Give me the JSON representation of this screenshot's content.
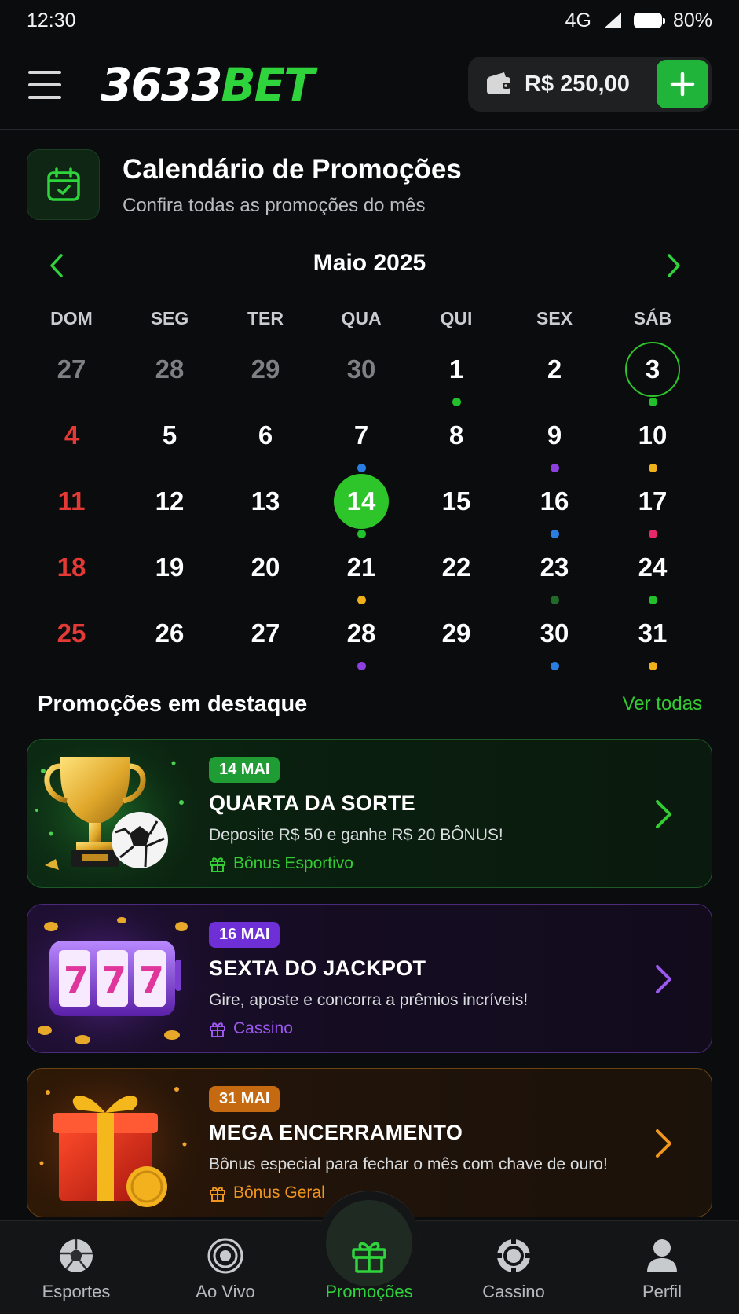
{
  "status_bar": {
    "time": "12:30",
    "network": "4G",
    "battery": "80%"
  },
  "header": {
    "logo_number": "3633",
    "logo_brand": "BET",
    "balance": "R$ 250,00"
  },
  "page": {
    "title": "Calendário de Promoções",
    "subtitle": "Confira todas as promoções do mês"
  },
  "calendar": {
    "month_label": "Maio 2025",
    "weekdays": [
      "DOM",
      "SEG",
      "TER",
      "QUA",
      "QUI",
      "SEX",
      "SÁB"
    ],
    "weeks": [
      [
        {
          "d": "27",
          "m": true
        },
        {
          "d": "28",
          "m": true
        },
        {
          "d": "29",
          "m": true
        },
        {
          "d": "30",
          "m": true
        },
        {
          "d": "1",
          "dot": "#22c02b"
        },
        {
          "d": "2"
        },
        {
          "d": "3",
          "dot": "#22c02b",
          "sel": true
        }
      ],
      [
        {
          "d": "4",
          "sun": true
        },
        {
          "d": "5"
        },
        {
          "d": "6"
        },
        {
          "d": "7",
          "dot": "#2a7de1"
        },
        {
          "d": "8"
        },
        {
          "d": "9",
          "dot": "#8e3fe0"
        },
        {
          "d": "10",
          "dot": "#f0b01a"
        }
      ],
      [
        {
          "d": "11",
          "sun": true
        },
        {
          "d": "12"
        },
        {
          "d": "13"
        },
        {
          "d": "14",
          "dot": "#22c02b",
          "today": true
        },
        {
          "d": "15"
        },
        {
          "d": "16",
          "dot": "#2a7de1"
        },
        {
          "d": "17",
          "dot": "#e9286a"
        }
      ],
      [
        {
          "d": "18",
          "sun": true
        },
        {
          "d": "19"
        },
        {
          "d": "20"
        },
        {
          "d": "21",
          "dot": "#f0b01a"
        },
        {
          "d": "22"
        },
        {
          "d": "23",
          "dot": "#1e6b2a"
        },
        {
          "d": "24",
          "dot": "#22c02b"
        }
      ],
      [
        {
          "d": "25",
          "sun": true
        },
        {
          "d": "26"
        },
        {
          "d": "27"
        },
        {
          "d": "28",
          "dot": "#8e3fe0"
        },
        {
          "d": "29"
        },
        {
          "d": "30",
          "dot": "#2a7de1"
        },
        {
          "d": "31",
          "dot": "#f0b01a"
        }
      ]
    ]
  },
  "featured": {
    "title": "Promoções em destaque",
    "see_all": "Ver todas",
    "promos": [
      {
        "badge": "14 MAI",
        "title": "QUARTA DA SORTE",
        "desc": "Deposite R$ 50 e ganhe R$ 20 BÔNUS!",
        "category": "Bônus Esportivo",
        "accent": "#33cc33"
      },
      {
        "badge": "16 MAI",
        "title": "SEXTA DO JACKPOT",
        "desc": "Gire, aposte e concorra a prêmios incríveis!",
        "category": "Cassino",
        "accent": "#9b59f0"
      },
      {
        "badge": "31 MAI",
        "title": "MEGA ENCERRAMENTO",
        "desc": "Bônus especial para fechar o mês com chave de ouro!",
        "category": "Bônus Geral",
        "accent": "#f0961f"
      }
    ]
  },
  "bottom_nav": {
    "items": [
      {
        "label": "Esportes",
        "icon": "soccer-ball-icon"
      },
      {
        "label": "Ao Vivo",
        "icon": "live-broadcast-icon"
      },
      {
        "label": "Promoções",
        "icon": "gift-icon",
        "active": true
      },
      {
        "label": "Cassino",
        "icon": "casino-chip-icon"
      },
      {
        "label": "Perfil",
        "icon": "user-icon"
      }
    ]
  },
  "colors": {
    "brand_green": "#2fd33c",
    "background": "#0b0c0d",
    "sunday_red": "#e53935"
  }
}
